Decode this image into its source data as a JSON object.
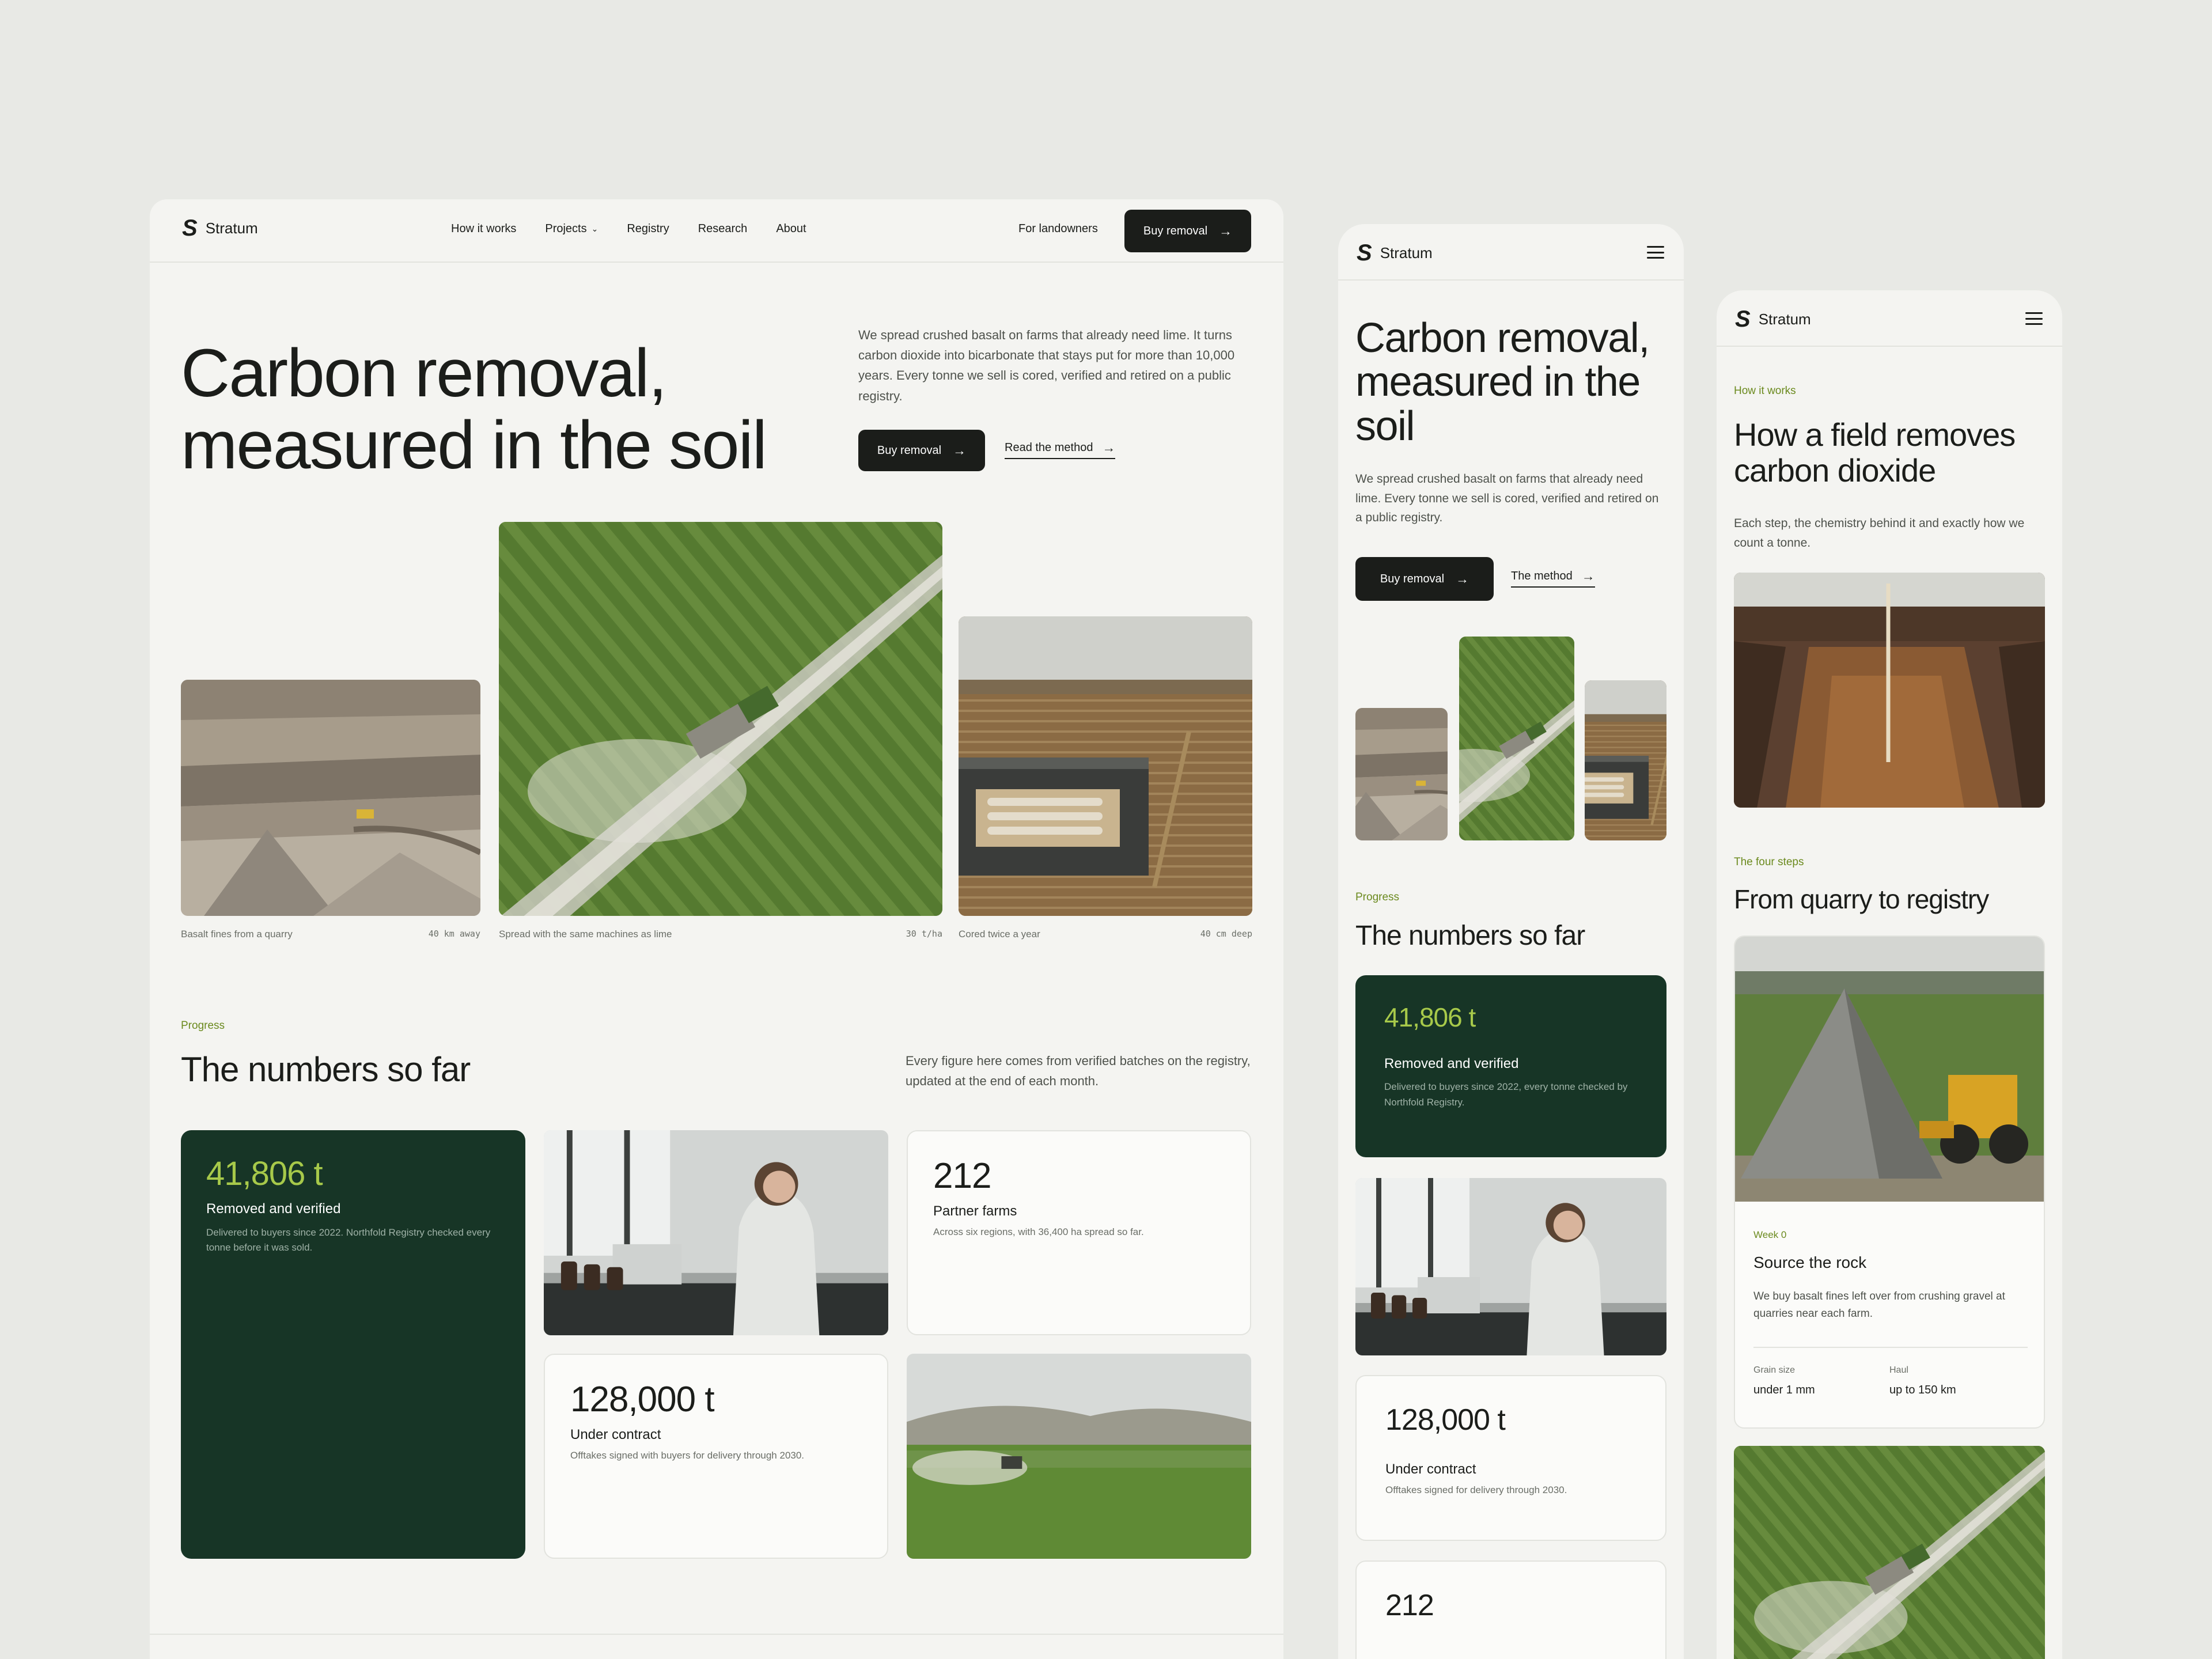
{
  "brand": {
    "name": "Stratum",
    "mark": "S"
  },
  "nav": {
    "items": [
      "How it works",
      "Projects",
      "Registry",
      "Research",
      "About"
    ],
    "landowners": "For landowners",
    "cta": "Buy removal"
  },
  "hero": {
    "title": "Carbon removal, measured in the soil",
    "desc_desktop": "We spread crushed basalt on farms that already need lime. It turns carbon dioxide into bicarbonate that stays put for more than 10,000 years. Every tonne we sell is cored, verified and retired on a public registry.",
    "desc_mobile": "We spread crushed basalt on farms that already need lime. Every tonne we sell is cored, verified and retired on a public registry.",
    "primary": "Buy removal",
    "secondary": "Read the method",
    "secondary_short": "The method"
  },
  "gallery": [
    {
      "caption": "Basalt fines from a quarry",
      "meta": "40 km away"
    },
    {
      "caption": "Spread with the same machines as lime",
      "meta": "30 t/ha"
    },
    {
      "caption": "Cored twice a year",
      "meta": "40 cm deep"
    }
  ],
  "numbers": {
    "eyebrow": "Progress",
    "title": "The numbers so far",
    "note": "Every figure here comes from verified batches on the registry, updated at the end of each month.",
    "removed": {
      "value": "41,806 t",
      "label": "Removed and verified",
      "desc": "Delivered to buyers since 2022. Northfold Registry checked every tonne before it was sold.",
      "desc_mobile": "Delivered to buyers since 2022, every tonne checked by Northfold Registry."
    },
    "farms": {
      "value": "212",
      "label": "Partner farms",
      "desc": "Across six regions, with 36,400 ha spread so far."
    },
    "contract": {
      "value": "128,000 t",
      "label": "Under contract",
      "desc": "Offtakes signed with buyers for delivery through 2030.",
      "desc_mobile": "Offtakes signed for delivery through 2030."
    }
  },
  "how": {
    "eyebrow": "How it works",
    "title": "How a field removes carbon dioxide",
    "desc": "Each step, the chemistry behind it and exactly how we count a tonne.",
    "steps_eyebrow": "The four steps",
    "steps_title": "From quarry to registry",
    "step1": {
      "week": "Week 0",
      "title": "Source the rock",
      "desc": "We buy basalt fines left over from crushing gravel at quarries near each farm.",
      "spec1_label": "Grain size",
      "spec1_value": "under 1 mm",
      "spec2_label": "Haul",
      "spec2_value": "up to 150 km"
    }
  },
  "colors": {
    "accent": "#6b8a1e",
    "dark_green": "#173526",
    "stat_green": "#a7c94a",
    "ink": "#1b1d1a"
  }
}
